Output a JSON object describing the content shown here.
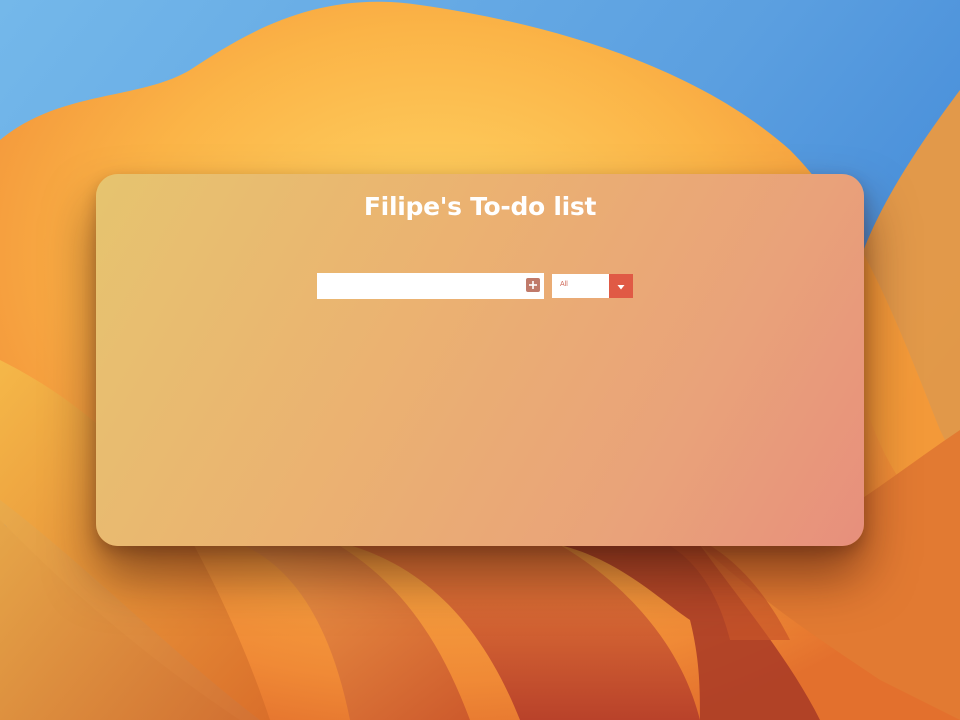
{
  "app": {
    "title": "Filipe's To-do list"
  },
  "todo_form": {
    "input_value": "",
    "input_placeholder": "",
    "add_button_icon": "plus-icon",
    "filter": {
      "selected": "All",
      "arrow_icon": "chevron-down-icon"
    }
  },
  "colors": {
    "title_text": "#ffffff",
    "add_button": "#c07a6a",
    "filter_arrow_bg": "#e05a45",
    "filter_text": "#d06a5a"
  }
}
